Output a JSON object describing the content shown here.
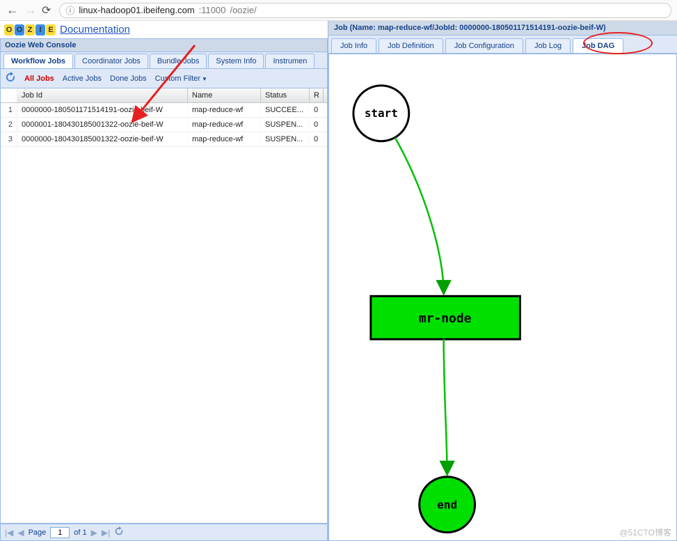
{
  "browser": {
    "url_prefix": "linux-hadoop01.ibeifeng.com",
    "url_port": ":11000",
    "url_path": "/oozie/"
  },
  "oozie": {
    "logo_letters": [
      "O",
      "O",
      "Z",
      "I",
      "E"
    ],
    "doc_label": "Documentation",
    "console_title": "Oozie Web Console"
  },
  "left_tabs": [
    {
      "label": "Workflow Jobs",
      "active": true
    },
    {
      "label": "Coordinator Jobs"
    },
    {
      "label": "Bundle Jobs"
    },
    {
      "label": "System Info"
    },
    {
      "label": "Instrumen"
    }
  ],
  "toolbar": {
    "all_jobs": "All Jobs",
    "active_jobs": "Active Jobs",
    "done_jobs": "Done Jobs",
    "custom_filter": "Custom Filter"
  },
  "grid": {
    "headers": {
      "jobid": "Job Id",
      "name": "Name",
      "status": "Status",
      "run": "R"
    },
    "rows": [
      {
        "num": "1",
        "id": "0000000-180501171514191-oozie-beif-W",
        "name": "map-reduce-wf",
        "status": "SUCCEE...",
        "run": "0"
      },
      {
        "num": "2",
        "id": "0000001-180430185001322-oozie-beif-W",
        "name": "map-reduce-wf",
        "status": "SUSPEN...",
        "run": "0"
      },
      {
        "num": "3",
        "id": "0000000-180430185001322-oozie-beif-W",
        "name": "map-reduce-wf",
        "status": "SUSPEN...",
        "run": "0"
      }
    ]
  },
  "paging": {
    "page_label": "Page",
    "page_value": "1",
    "of_label": "of 1"
  },
  "right": {
    "title_truncated": "Job (Name: map-reduce-wf/JobId: 0000000-180501171514191-oozie-beif-W)",
    "tabs": [
      {
        "label": "Job Info"
      },
      {
        "label": "Job Definition"
      },
      {
        "label": "Job Configuration"
      },
      {
        "label": "Job Log"
      },
      {
        "label": "Job DAG",
        "active": true
      }
    ],
    "dag": {
      "start": "start",
      "mid": "mr-node",
      "end": "end"
    }
  },
  "watermark": "@51CTO博客",
  "chart_data": {
    "type": "diagram",
    "nodes": [
      {
        "id": "start",
        "label": "start",
        "shape": "circle",
        "fill": "#ffffff"
      },
      {
        "id": "mr-node",
        "label": "mr-node",
        "shape": "rect",
        "fill": "#00e000"
      },
      {
        "id": "end",
        "label": "end",
        "shape": "circle",
        "fill": "#00e000"
      }
    ],
    "edges": [
      {
        "from": "start",
        "to": "mr-node",
        "color": "#00c000"
      },
      {
        "from": "mr-node",
        "to": "end",
        "color": "#00c000"
      }
    ]
  }
}
